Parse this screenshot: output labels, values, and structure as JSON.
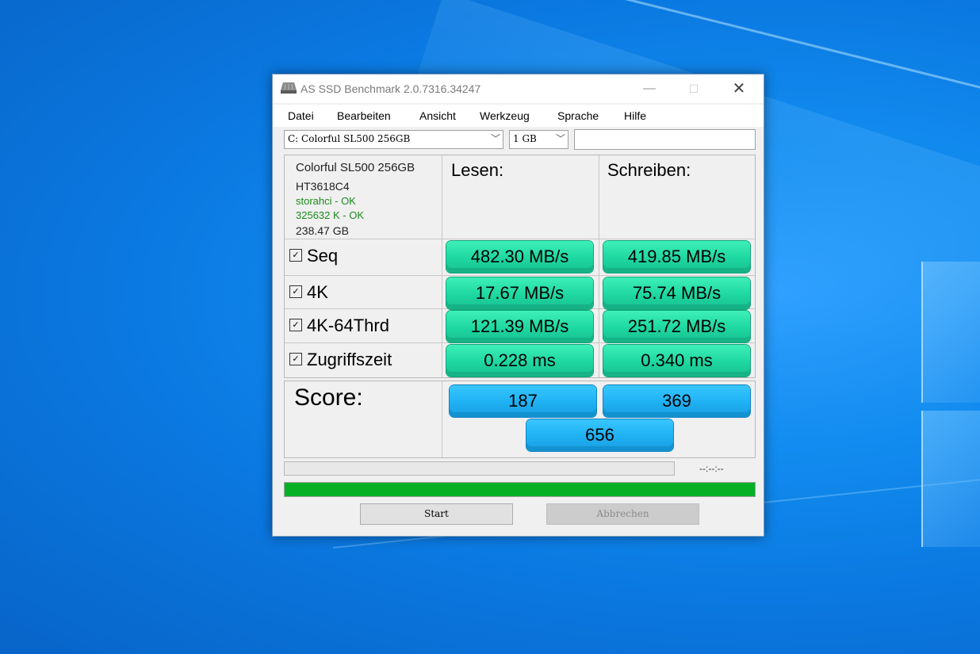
{
  "window": {
    "title": "AS SSD Benchmark 2.0.7316.34247",
    "controls": {
      "minimize": "—",
      "maximize": "☐",
      "close": "✕"
    }
  },
  "menu": [
    "Datei",
    "Bearbeiten",
    "Ansicht",
    "Werkzeug",
    "Sprache",
    "Hilfe"
  ],
  "drive_select": {
    "value": "C: Colorful SL500 256GB"
  },
  "size_select": {
    "value": "1 GB"
  },
  "drive_info": {
    "name": "Colorful SL500 256GB",
    "firmware": "HT3618C4",
    "driver": "storahci - OK",
    "alignment": "325632 K - OK",
    "capacity": "238.47 GB"
  },
  "columns": {
    "read": "Lesen:",
    "write": "Schreiben:"
  },
  "rows": [
    {
      "label": "Seq",
      "checked": true,
      "read": "482.30 MB/s",
      "write": "419.85 MB/s"
    },
    {
      "label": "4K",
      "checked": true,
      "read": "17.67 MB/s",
      "write": "75.74 MB/s"
    },
    {
      "label": "4K-64Thrd",
      "checked": true,
      "read": "121.39 MB/s",
      "write": "251.72 MB/s"
    },
    {
      "label": "Zugriffszeit",
      "checked": true,
      "read": "0.228 ms",
      "write": "0.340 ms"
    }
  ],
  "score": {
    "title": "Score:",
    "read": "187",
    "write": "369",
    "total": "656"
  },
  "time_display": "--:--:--",
  "progress": {
    "main": 1.0
  },
  "buttons": {
    "start": "Start",
    "abort": "Abbrechen"
  },
  "colors": {
    "result_green": "#1ed7a0",
    "score_blue": "#1eb1f3",
    "progress_green": "#06b025"
  }
}
